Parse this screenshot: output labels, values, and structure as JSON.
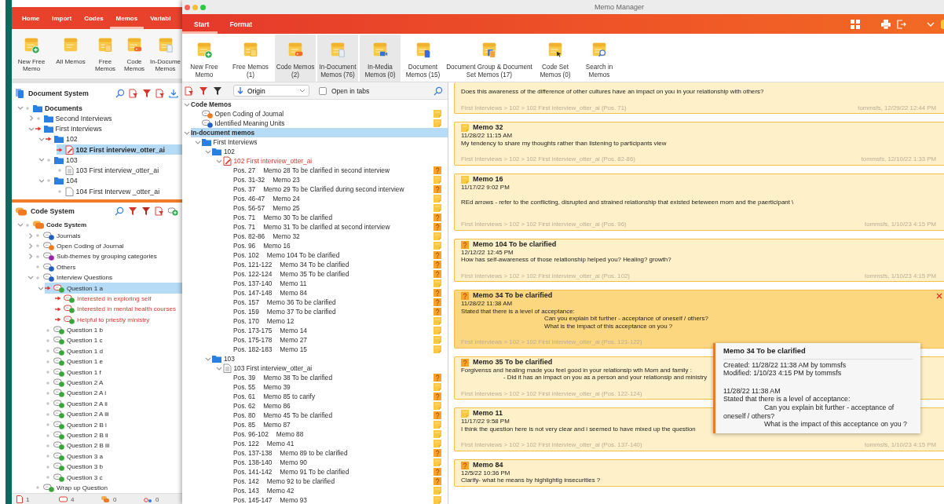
{
  "background_window": {
    "ribbon_tabs": [
      {
        "label": "Home",
        "selected": false
      },
      {
        "label": "Import",
        "selected": false
      },
      {
        "label": "Codes",
        "selected": false
      },
      {
        "label": "Memos",
        "selected": true
      },
      {
        "label": "Variabl",
        "selected": false
      }
    ],
    "toolbar": [
      {
        "label": "New Free\nMemo",
        "kind": "new"
      },
      {
        "label": "All Memos",
        "kind": "all"
      },
      {
        "label": "Free\nMemos",
        "kind": "free"
      },
      {
        "label": "Code\nMemos",
        "kind": "code"
      },
      {
        "label": "In-Docume\nMemos",
        "kind": "indocument"
      }
    ],
    "document_system": {
      "title": "Document System",
      "tree": [
        {
          "kind": "root",
          "label": "Documents",
          "expanded": true,
          "activated": false,
          "selected": false,
          "children": [
            {
              "kind": "folder",
              "label": "Second Interviews",
              "expanded": false,
              "activated": false,
              "selected": false
            },
            {
              "kind": "folder",
              "label": "First Interviews",
              "expanded": true,
              "activated": true,
              "selected": false,
              "children": [
                {
                  "kind": "folder",
                  "label": "102",
                  "expanded": true,
                  "activated": true,
                  "selected": false,
                  "children": [
                    {
                      "kind": "editeddoc",
                      "label": "102 First interview_otter_ai",
                      "activated": true,
                      "selected": true
                    }
                  ]
                },
                {
                  "kind": "folder",
                  "label": "103",
                  "expanded": true,
                  "activated": false,
                  "selected": false,
                  "children": [
                    {
                      "kind": "textdoc",
                      "label": "103 First interview_otter_ai",
                      "activated": false,
                      "selected": false
                    }
                  ]
                },
                {
                  "kind": "folder",
                  "label": "104",
                  "expanded": true,
                  "activated": false,
                  "selected": false,
                  "children": [
                    {
                      "kind": "emptydoc",
                      "label": "104 First Intervew _otter_ai",
                      "activated": false,
                      "selected": false
                    }
                  ]
                }
              ]
            }
          ]
        }
      ]
    },
    "code_system": {
      "title": "Code System",
      "tree": [
        {
          "kind": "root",
          "label": "Code System",
          "expanded": true,
          "activated": false,
          "selected": false,
          "children": [
            {
              "kind": "code",
              "label": "Journals",
              "color": "#2060c0",
              "expanded": false,
              "activated": false,
              "selected": false
            },
            {
              "kind": "code",
              "label": "Open Coding of Journal",
              "color": "#f07820",
              "expanded": false,
              "activated": false,
              "selected": false
            },
            {
              "kind": "code",
              "label": "Sub-themes by grouping categories",
              "color": "#a020b0",
              "expanded": false,
              "activated": false,
              "selected": false
            },
            {
              "kind": "code",
              "label": "Others",
              "color": "#2060c0",
              "activated": false,
              "selected": false
            },
            {
              "kind": "code",
              "label": "Interview Questions",
              "color": "#2060c0",
              "expanded": true,
              "activated": false,
              "selected": false,
              "children": [
                {
                  "kind": "code",
                  "label": "Question 1 a",
                  "color": "#3aa53a",
                  "expanded": true,
                  "activated": true,
                  "selected": true,
                  "children": [
                    {
                      "kind": "code",
                      "label": "Interested in exploring self",
                      "color": "#3aa53a",
                      "activated": true,
                      "selected": false
                    },
                    {
                      "kind": "code",
                      "label": "Interested in mental health courses",
                      "color": "#3aa53a",
                      "activated": true,
                      "selected": false
                    },
                    {
                      "kind": "code",
                      "label": "Helpful to priestly ministry",
                      "color": "#3aa53a",
                      "activated": true,
                      "selected": false
                    }
                  ]
                },
                {
                  "kind": "code",
                  "label": "Question 1 b",
                  "color": "#3aa53a",
                  "activated": false,
                  "selected": false
                },
                {
                  "kind": "code",
                  "label": "Question 1 c",
                  "color": "#3aa53a",
                  "activated": false,
                  "selected": false
                },
                {
                  "kind": "code",
                  "label": "Question 1 d",
                  "color": "#3aa53a",
                  "activated": false,
                  "selected": false
                },
                {
                  "kind": "code",
                  "label": "Question 1 e",
                  "color": "#3aa53a",
                  "activated": false,
                  "selected": false
                },
                {
                  "kind": "code",
                  "label": "Question 1 f",
                  "color": "#3aa53a",
                  "activated": false,
                  "selected": false
                },
                {
                  "kind": "code",
                  "label": "Question 2 A",
                  "color": "#3aa53a",
                  "activated": false,
                  "selected": false
                },
                {
                  "kind": "code",
                  "label": "Question 2 A i",
                  "color": "#3aa53a",
                  "activated": false,
                  "selected": false
                },
                {
                  "kind": "code",
                  "label": "Question 2 A ii",
                  "color": "#3aa53a",
                  "activated": false,
                  "selected": false
                },
                {
                  "kind": "code",
                  "label": "Question 2 A iii",
                  "color": "#3aa53a",
                  "activated": false,
                  "selected": false
                },
                {
                  "kind": "code",
                  "label": "Question 2 B i",
                  "color": "#3aa53a",
                  "activated": false,
                  "selected": false
                },
                {
                  "kind": "code",
                  "label": "Question 2 B ii",
                  "color": "#3aa53a",
                  "activated": false,
                  "selected": false
                },
                {
                  "kind": "code",
                  "label": "Question 2 B iii",
                  "color": "#3aa53a",
                  "activated": false,
                  "selected": false
                },
                {
                  "kind": "code",
                  "label": "Question 3 a",
                  "color": "#3aa53a",
                  "activated": false,
                  "selected": false
                },
                {
                  "kind": "code",
                  "label": "Question 3 b",
                  "color": "#3aa53a",
                  "activated": false,
                  "selected": false
                },
                {
                  "kind": "code",
                  "label": "Question 3 c",
                  "color": "#3aa53a",
                  "activated": false,
                  "selected": false
                }
              ]
            },
            {
              "kind": "code",
              "label": "Wrap up Question",
              "color": "#3aa53a",
              "activated": false,
              "selected": false
            }
          ]
        }
      ]
    },
    "status_bar": [
      {
        "kind": "document",
        "count": "1"
      },
      {
        "kind": "code",
        "count": "4"
      },
      {
        "kind": "set",
        "count": "0"
      },
      {
        "kind": "link",
        "count": "0"
      }
    ]
  },
  "memo_manager": {
    "title": "Memo Manager",
    "ribbon_tabs": [
      {
        "label": "Start",
        "selected": true
      },
      {
        "label": "Format",
        "selected": false
      }
    ],
    "toolbar": [
      {
        "label": "New Free\nMemo",
        "kind": "new",
        "selected": false
      },
      {
        "label": "Free Memos\n(1)",
        "kind": "free",
        "selected": false
      },
      {
        "label": "Code Memos\n(2)",
        "kind": "code",
        "selected": true
      },
      {
        "label": "In-Document\nMemos (76)",
        "kind": "indocument",
        "selected": true
      },
      {
        "label": "In-Media\nMemos (0)",
        "kind": "inmedia",
        "selected": true
      },
      {
        "label": "Document\nMemos (15)",
        "kind": "document",
        "selected": false
      },
      {
        "label": "Document Group & Document\nSet Memos (17)",
        "kind": "documentgroup",
        "selected": false
      },
      {
        "label": "Code Set\nMemos (0)",
        "kind": "codeset",
        "selected": false
      },
      {
        "label": "Search in\nMemos",
        "kind": "search",
        "selected": false
      }
    ],
    "tree_toolbar": {
      "sort": "Origin",
      "open_in_tabs": {
        "label": "Open in tabs",
        "checked": false
      }
    },
    "tree": [
      {
        "kind": "group",
        "label": "Code Memos",
        "expanded": true,
        "selected": false,
        "children": [
          {
            "kind": "code",
            "label": "Open Coding of Journal",
            "color": "#f07820",
            "to_clarify": false,
            "selected": false
          },
          {
            "kind": "code",
            "label": "Identified Meaning Units",
            "color": "#2060c0",
            "to_clarify": false,
            "selected": false
          }
        ]
      },
      {
        "kind": "group",
        "label": "In-document memos",
        "expanded": true,
        "selected": true,
        "children": [
          {
            "kind": "folder",
            "label": "First Interviews",
            "expanded": true,
            "selected": false,
            "children": [
              {
                "kind": "folder",
                "label": "102",
                "expanded": true,
                "selected": false,
                "children": [
                  {
                    "kind": "editeddoc",
                    "label": "102 First interview_otter_ai",
                    "expanded": true,
                    "activated": true,
                    "selected": false,
                    "children": [
                      {
                        "kind": "memo",
                        "pos": "Pos. 27",
                        "label": "Memo 28 To be clarified in second interview",
                        "to_clarify": true,
                        "selected": false
                      },
                      {
                        "kind": "memo",
                        "pos": "Pos. 31-32",
                        "label": "Memo 23",
                        "to_clarify": false,
                        "selected": false
                      },
                      {
                        "kind": "memo",
                        "pos": "Pos. 37",
                        "label": "Memo 29 To be Clarified during second interview",
                        "to_clarify": true,
                        "selected": false
                      },
                      {
                        "kind": "memo",
                        "pos": "Pos. 46-47",
                        "label": "Memo 24",
                        "to_clarify": false,
                        "selected": false
                      },
                      {
                        "kind": "memo",
                        "pos": "Pos. 56-57",
                        "label": "Memo 25",
                        "to_clarify": false,
                        "selected": false
                      },
                      {
                        "kind": "memo",
                        "pos": "Pos. 71",
                        "label": "Memo 30 To be clarified",
                        "to_clarify": true,
                        "selected": false
                      },
                      {
                        "kind": "memo",
                        "pos": "Pos. 71",
                        "label": "Memo 31 To be clarified at second interview",
                        "to_clarify": true,
                        "selected": false
                      },
                      {
                        "kind": "memo",
                        "pos": "Pos. 82-86",
                        "label": "Memo 32",
                        "to_clarify": false,
                        "selected": false
                      },
                      {
                        "kind": "memo",
                        "pos": "Pos. 96",
                        "label": "Memo 16",
                        "to_clarify": false,
                        "selected": false
                      },
                      {
                        "kind": "memo",
                        "pos": "Pos. 102",
                        "label": "Memo 104 To be clarified",
                        "to_clarify": true,
                        "selected": false
                      },
                      {
                        "kind": "memo",
                        "pos": "Pos. 121-122",
                        "label": "Memo 34 To be clarified",
                        "to_clarify": true,
                        "selected": false
                      },
                      {
                        "kind": "memo",
                        "pos": "Pos. 122-124",
                        "label": "Memo 35 To be clarified",
                        "to_clarify": true,
                        "selected": false
                      },
                      {
                        "kind": "memo",
                        "pos": "Pos. 137-140",
                        "label": "Memo 11",
                        "to_clarify": false,
                        "selected": false
                      },
                      {
                        "kind": "memo",
                        "pos": "Pos. 147-148",
                        "label": "Memo 84",
                        "to_clarify": true,
                        "selected": false
                      },
                      {
                        "kind": "memo",
                        "pos": "Pos. 157",
                        "label": "Memo 36 To be clarified",
                        "to_clarify": true,
                        "selected": false
                      },
                      {
                        "kind": "memo",
                        "pos": "Pos. 159",
                        "label": "Memo 37 To be clarified",
                        "to_clarify": true,
                        "selected": false
                      },
                      {
                        "kind": "memo",
                        "pos": "Pos. 170",
                        "label": "Memo 12",
                        "to_clarify": false,
                        "selected": false
                      },
                      {
                        "kind": "memo",
                        "pos": "Pos. 173-175",
                        "label": "Memo 14",
                        "to_clarify": false,
                        "selected": false
                      },
                      {
                        "kind": "memo",
                        "pos": "Pos. 175-178",
                        "label": "Memo 27",
                        "to_clarify": false,
                        "selected": false
                      },
                      {
                        "kind": "memo",
                        "pos": "Pos. 182-183",
                        "label": "Memo 15",
                        "to_clarify": false,
                        "selected": false
                      }
                    ]
                  }
                ]
              },
              {
                "kind": "folder",
                "label": "103",
                "expanded": true,
                "selected": false,
                "children": [
                  {
                    "kind": "textdoc",
                    "label": "103 First interview_otter_ai",
                    "expanded": true,
                    "activated": false,
                    "selected": false,
                    "children": [
                      {
                        "kind": "memo",
                        "pos": "Pos. 39",
                        "label": "Memo 38 To be clarified",
                        "to_clarify": true,
                        "selected": false
                      },
                      {
                        "kind": "memo",
                        "pos": "Pos. 55",
                        "label": "Memo 39",
                        "to_clarify": false,
                        "selected": false
                      },
                      {
                        "kind": "memo",
                        "pos": "Pos. 61",
                        "label": "Memo 85 to carify",
                        "to_clarify": true,
                        "selected": false
                      },
                      {
                        "kind": "memo",
                        "pos": "Pos. 62",
                        "label": "Memo 86",
                        "to_clarify": false,
                        "selected": false
                      },
                      {
                        "kind": "memo",
                        "pos": "Pos. 80",
                        "label": "Memo 45 To be clarified",
                        "to_clarify": true,
                        "selected": false
                      },
                      {
                        "kind": "memo",
                        "pos": "Pos. 85",
                        "label": "Memo 87",
                        "to_clarify": false,
                        "selected": false
                      },
                      {
                        "kind": "memo",
                        "pos": "Pos. 96-102",
                        "label": "Memo 88",
                        "to_clarify": false,
                        "selected": false
                      },
                      {
                        "kind": "memo",
                        "pos": "Pos. 122",
                        "label": "Memo 41",
                        "to_clarify": false,
                        "selected": false
                      },
                      {
                        "kind": "memo",
                        "pos": "Pos. 137-138",
                        "label": "Memo 89 to be clarified",
                        "to_clarify": true,
                        "selected": false
                      },
                      {
                        "kind": "memo",
                        "pos": "Pos. 138-140",
                        "label": "Memo 90",
                        "to_clarify": false,
                        "selected": false
                      },
                      {
                        "kind": "memo",
                        "pos": "Pos. 141-142",
                        "label": "Memo 91 To be clarified",
                        "to_clarify": true,
                        "selected": false
                      },
                      {
                        "kind": "memo",
                        "pos": "Pos. 142",
                        "label": "Memo 92 to be clarified",
                        "to_clarify": true,
                        "selected": false
                      },
                      {
                        "kind": "memo",
                        "pos": "Pos. 143",
                        "label": "Memo 42",
                        "to_clarify": false,
                        "selected": false
                      },
                      {
                        "kind": "memo",
                        "pos": "Pos. 145-147",
                        "label": "Memo 93",
                        "to_clarify": false,
                        "selected": false
                      }
                    ]
                  }
                ]
              }
            ]
          }
        ]
      }
    ],
    "cards": [
      {
        "body": [
          {
            "text": "Does this awareness of the difference of other cultures have an impact on you in your relationship with others?",
            "kind": "plain"
          }
        ],
        "path": "First Interviews > 102 > 102 First interview_otter_ai (Pos. 71)",
        "author": "tommsfs, 12/29/22 12:44 PM",
        "selected": false
      },
      {
        "title": "Memo 32",
        "to_clarify": false,
        "date": "11/28/22 11:15 AM",
        "body": [
          {
            "text": "My tendency to share my thoughts rather than listening to participants view",
            "kind": "plain"
          }
        ],
        "path": "First Interviews > 102 > 102 First interview_otter_ai (Pos. 82-86)",
        "author": "tommsfs, 12/10/22 1:33 PM",
        "selected": false
      },
      {
        "title": "Memo 16",
        "to_clarify": false,
        "date": "11/17/22 9:02 PM",
        "body": [
          {
            "text": "REd arrows - refer to the conflicting, disrupted and strained relationship that existed beteween mom and the paerticipant \\",
            "kind": "spaced"
          }
        ],
        "path": "First Interviews > 102 > 102 First interview_otter_ai (Pos. 96)",
        "author": "tommsfs, 1/10/23 4:15 PM",
        "selected": false
      },
      {
        "title": "Memo 104 To be clarified",
        "to_clarify": true,
        "date": "12/12/22 12:45 PM",
        "body": [
          {
            "text": "How has self-awareness of those relationship helped you? Healing? growth?",
            "kind": "plain"
          }
        ],
        "path": "First Interviews > 102 > 102 First interview_otter_ai (Pos. 102)",
        "author": "tommsfs, 1/10/23 4:15 PM",
        "selected": false
      },
      {
        "title": "Memo 34 To be clarified",
        "to_clarify": true,
        "date": "11/28/22 11:38 AM",
        "body": [
          {
            "text": "Stated that there is a level of acceptance:",
            "kind": "plain"
          },
          {
            "text": "Can you explain bit further - acceptance of oneself / others?",
            "kind": "doubleindented"
          },
          {
            "text": "What is the impact of this acceptance on you ?",
            "kind": "doubleindented"
          }
        ],
        "path": "First Interviews > 102 > 102 First interview_otter_ai (Pos. 121-122)",
        "selected": true
      },
      {
        "title": "Memo 35 To be clarified",
        "to_clarify": true,
        "body": [
          {
            "text": "Forgivenss and healing made you feel good in your relationsip wth Mom and family :",
            "kind": "plain"
          },
          {
            "text": "- Did it has an impact on you as a person and your relationsip and ministry",
            "kind": "indented"
          }
        ],
        "path": "First Interviews > 102 > 102 First interview_otter_ai (Pos. 122-124)",
        "selected": false
      },
      {
        "title": "Memo 11",
        "to_clarify": false,
        "date": "11/17/22 9:58 PM",
        "body": [
          {
            "text": "I think the question here is not very clear and i seemed to have mixed up the question",
            "kind": "plain"
          }
        ],
        "path": "First Interviews > 102 > 102 First interview_otter_ai (Pos. 137-140)",
        "author": "tommsfs, 1/10/23 4:15 PM",
        "selected": false
      },
      {
        "title": "Memo 84",
        "to_clarify": true,
        "date": "12/5/22 10:36 PM",
        "body": [
          {
            "text": "Clarify- what he means by highlightig insecurities ?",
            "kind": "plain"
          }
        ],
        "selected": false
      }
    ],
    "tooltip": {
      "title": "Memo 34 To be clarified",
      "created": "Created: 11/28/22 11:38 AM by tommsfs",
      "modified": "Modified: 1/10/23 4:15 PM by tommsfs",
      "date": "11/28/22 11:38 AM",
      "body": [
        {
          "text": "Stated that there is a level of acceptance:",
          "kind": "plain"
        },
        {
          "text": "Can you explain bit further - acceptance of oneself / others?",
          "kind": "indented"
        },
        {
          "text": "What is the impact of this acceptance on you ?",
          "kind": "indented"
        }
      ]
    }
  }
}
